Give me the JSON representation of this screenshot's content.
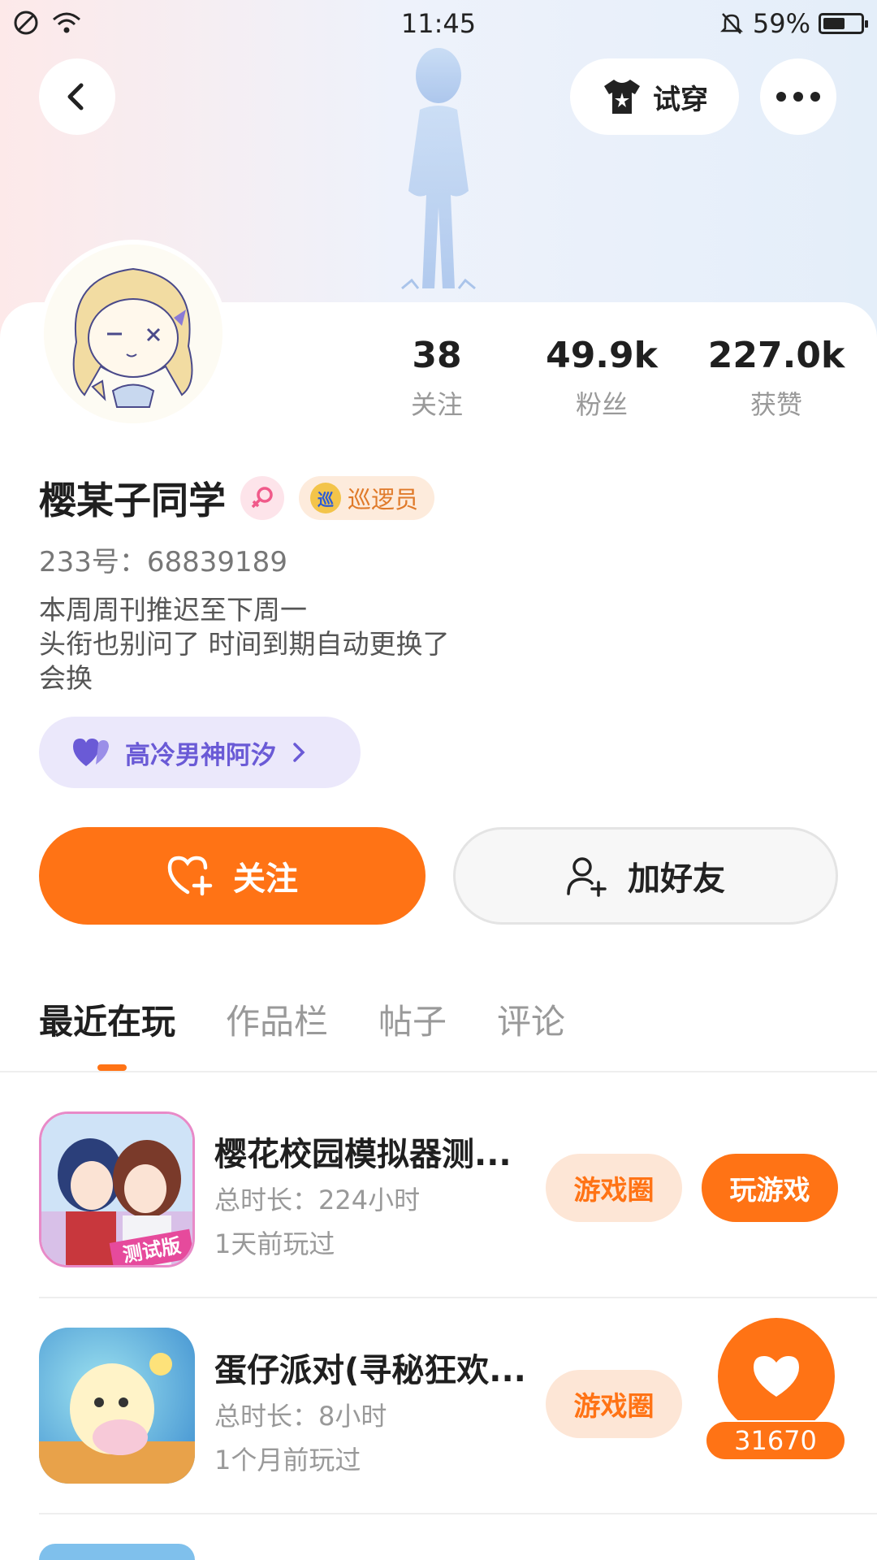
{
  "status_bar": {
    "time": "11:45",
    "battery_pct": "59%",
    "battery_level": 0.59
  },
  "header": {
    "try_on_label": "试穿"
  },
  "profile": {
    "stats": [
      {
        "value": "38",
        "label": "关注"
      },
      {
        "value": "49.9k",
        "label": "粉丝"
      },
      {
        "value": "227.0k",
        "label": "获赞"
      }
    ],
    "name": "樱某子同学",
    "badge_label": "巡逻员",
    "badge_icon_text": "巡",
    "uid": "233号：68839189",
    "bio_lines": [
      "本周周刊推迟至下周一",
      "头衔也别问了 时间到期自动更换了",
      "会换"
    ],
    "couple_label": "高冷男神阿汐",
    "follow_label": "关注",
    "add_friend_label": "加好友"
  },
  "tabs": [
    "最近在玩",
    "作品栏",
    "帖子",
    "评论"
  ],
  "games": [
    {
      "title": "樱花校园模拟器测...",
      "total_time": "总时长：224小时",
      "last_played": "1天前玩过",
      "circle_label": "游戏圈",
      "play_label": "玩游戏",
      "icon_text": "测试版"
    },
    {
      "title": "蛋仔派对(寻秘狂欢...",
      "total_time": "总时长：8小时",
      "last_played": "1个月前玩过",
      "circle_label": "游戏圈"
    }
  ],
  "like_float": {
    "count": "31670"
  },
  "colors": {
    "accent": "#ff7315",
    "couple": "#6a5ad6"
  }
}
